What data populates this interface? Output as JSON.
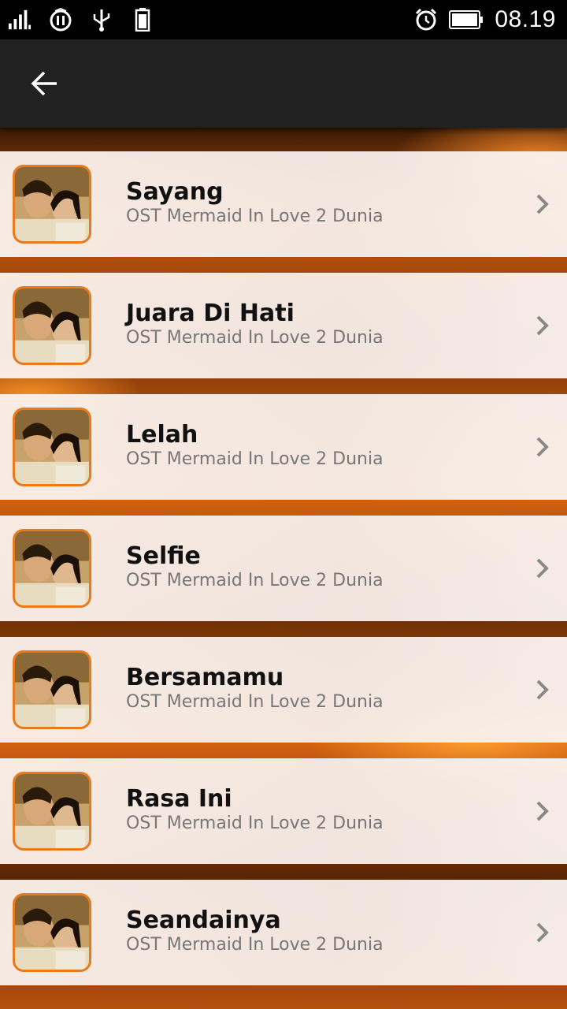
{
  "status_bar": {
    "time": "08.19",
    "icons": [
      "signal-icon",
      "pause-circle-icon",
      "usb-icon",
      "battery-saver-icon",
      "alarm-icon",
      "battery-icon"
    ]
  },
  "app_bar": {
    "back_icon": "arrow-left-icon"
  },
  "songs": [
    {
      "title": "Sayang",
      "subtitle": "OST Mermaid In Love 2 Dunia"
    },
    {
      "title": "Juara Di Hati",
      "subtitle": "OST Mermaid In Love 2 Dunia"
    },
    {
      "title": "Lelah",
      "subtitle": "OST Mermaid In Love 2 Dunia"
    },
    {
      "title": "Selfie",
      "subtitle": "OST Mermaid In Love 2 Dunia"
    },
    {
      "title": "Bersamamu",
      "subtitle": "OST Mermaid In Love 2 Dunia"
    },
    {
      "title": "Rasa Ini",
      "subtitle": "OST Mermaid In Love 2 Dunia"
    },
    {
      "title": "Seandainya",
      "subtitle": "OST Mermaid In Love 2 Dunia"
    }
  ],
  "colors": {
    "app_bar": "#212121",
    "accent": "#e87a1c",
    "title_text": "#111111",
    "subtitle_text": "#777777"
  }
}
